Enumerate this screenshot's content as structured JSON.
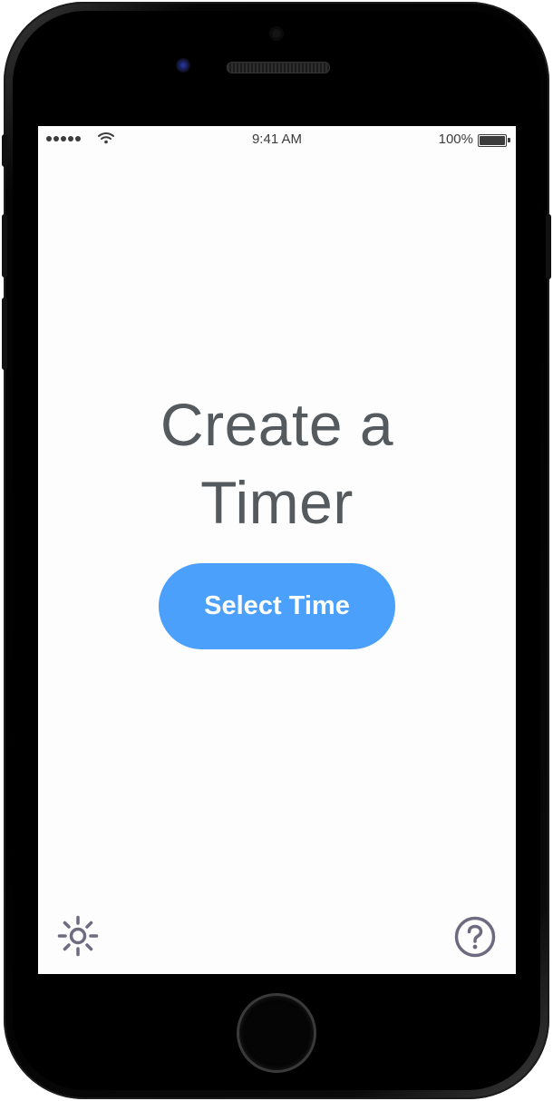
{
  "status_bar": {
    "time": "9:41 AM",
    "battery": "100%"
  },
  "main": {
    "title_line1": "Create a",
    "title_line2": "Timer",
    "select_button_label": "Select Time"
  },
  "icons": {
    "settings": "sun-gear-icon",
    "help": "question-circle-icon"
  },
  "colors": {
    "accent": "#4aa0fb",
    "title_text": "#555a5e",
    "icon": "#6e6b80"
  }
}
